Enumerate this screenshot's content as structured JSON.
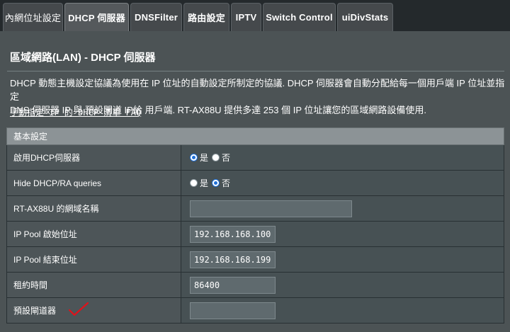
{
  "tabs": [
    {
      "label": "內網位址設定",
      "active": false
    },
    {
      "label": "DHCP 伺服器",
      "active": true
    },
    {
      "label": "DNSFilter",
      "active": false
    },
    {
      "label": "路由設定",
      "active": false
    },
    {
      "label": "IPTV",
      "active": false
    },
    {
      "label": "Switch Control",
      "active": false
    },
    {
      "label": "uiDivStats",
      "active": false
    }
  ],
  "page": {
    "title": "區域網路(LAN) - DHCP 伺服器",
    "description_line1": "DHCP 動態主機設定協議為使用在 IP 位址的自動設定所制定的協議. DHCP 伺服器會自動分配給每一個用戶端 IP 位址並指定",
    "description_line2": "DNS 伺服器 IP 與 預設閘道 IP給 用戶端. RT-AX88U 提供多達 253 個 IP 位址讓您的區域網路設備使用.",
    "faq_link": "手動指定 IP 的 DHCP 清單 FAQ"
  },
  "settings": {
    "section_title": "基本設定",
    "enable_dhcp": {
      "label": "啟用DHCP伺服器",
      "yes": "是",
      "no": "否",
      "selected": "yes"
    },
    "hide_dhcp": {
      "label": "Hide DHCP/RA queries",
      "yes": "是",
      "no": "否",
      "selected": "no"
    },
    "domain_name": {
      "label": "RT-AX88U 的網域名稱",
      "value": ""
    },
    "pool_start": {
      "label": "IP Pool 啟始位址",
      "value": "192.168.168.100"
    },
    "pool_end": {
      "label": "IP Pool 結束位址",
      "value": "192.168.168.199"
    },
    "lease_time": {
      "label": "租約時間",
      "value": "86400"
    },
    "default_gateway": {
      "label": "預設閘道器",
      "value": ""
    }
  },
  "colors": {
    "accent_checkmark": "#e0121b",
    "radio_selected": "#1e6fd8"
  }
}
